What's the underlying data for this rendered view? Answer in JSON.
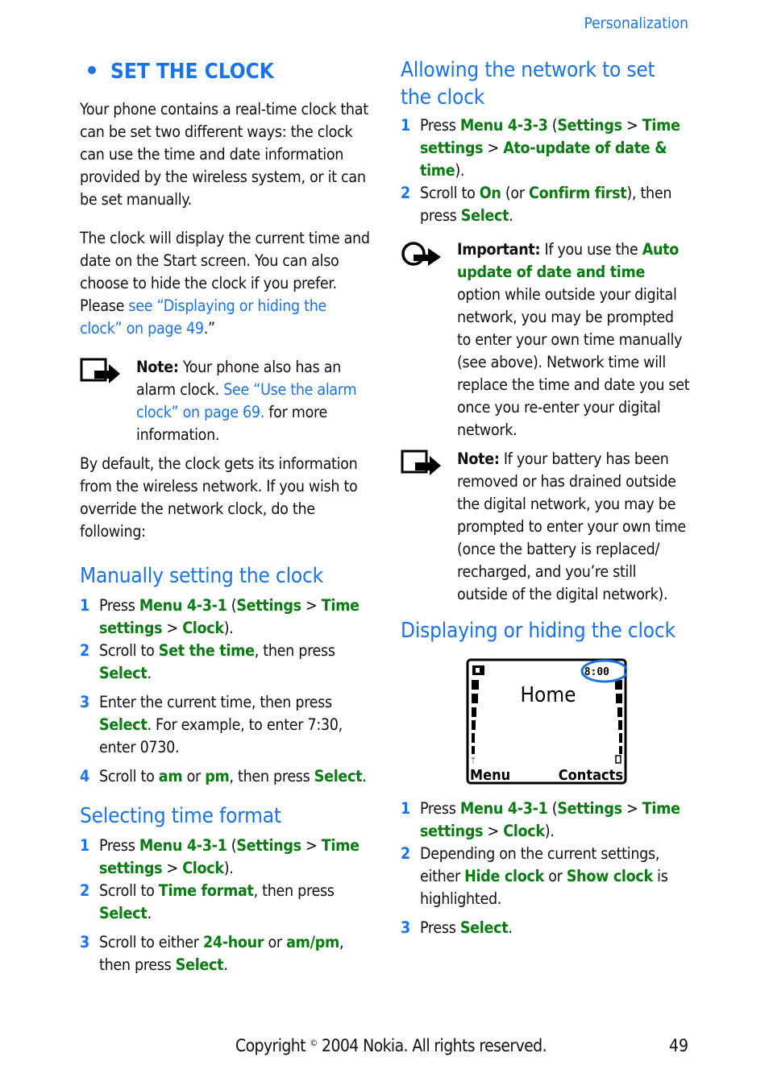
{
  "header": {
    "section": "Personalization"
  },
  "left": {
    "title": "SET THE CLOCK",
    "intro": "Your phone contains a real-time clock that can be set two different ways: the clock can use the time and date information provided by the wireless system, or it can be set manually.",
    "para2_text": "The clock will display the current time and date on the Start screen. You can also choose to hide the clock if you prefer. Please ",
    "para2_link": "see “Displaying or hiding the clock” on page 49",
    "para2_end": ".”",
    "note": {
      "label": "Note:",
      "text": " Your phone also has an alarm clock. ",
      "link": "See “Use the alarm clock” on page 69.",
      "end": " for more information."
    },
    "para3": "By default, the clock gets its information from the wireless network. If you wish to override the network clock, do the following:",
    "manual": {
      "heading": "Manually setting the clock",
      "steps": [
        {
          "num": "1",
          "t1": "Press ",
          "k1": "Menu 4-3-1",
          "t2": " (",
          "k2": "Settings",
          "t3": " > ",
          "k3": "Time settings",
          "t4": " > ",
          "k4": "Clock",
          "t5": ")."
        },
        {
          "num": "2",
          "t1": "Scroll to ",
          "k1": "Set the time",
          "t2": ", then press ",
          "k2": "Select",
          "t3": "."
        },
        {
          "num": "3",
          "t1": "Enter the current time, then press ",
          "k1": "Select",
          "t2": ". For example, to enter 7:30, enter 0730."
        },
        {
          "num": "4",
          "t1": "Scroll to ",
          "k1": "am",
          "t2": " or ",
          "k2": "pm",
          "t3": ", then press ",
          "k3": "Select",
          "t4": "."
        }
      ]
    },
    "format": {
      "heading": "Selecting time format",
      "steps": [
        {
          "num": "1",
          "t1": "Press ",
          "k1": "Menu 4-3-1",
          "t2": " (",
          "k2": "Settings",
          "t3": " > ",
          "k3": "Time settings",
          "t4": " > ",
          "k4": "Clock",
          "t5": ")."
        },
        {
          "num": "2",
          "t1": "Scroll to ",
          "k1": "Time format",
          "t2": ", then press ",
          "k2": "Select",
          "t3": "."
        },
        {
          "num": "3",
          "t1": "Scroll to either ",
          "k1": "24-hour",
          "t2": " or ",
          "k2": "am/pm",
          "t3": ", then press ",
          "k3": "Select",
          "t4": "."
        }
      ]
    }
  },
  "right": {
    "network": {
      "heading": "Allowing the network to set the clock",
      "steps": [
        {
          "num": "1",
          "t1": "Press ",
          "k1": "Menu 4-3-3",
          "t2": " (",
          "k2": "Settings",
          "t3": " > ",
          "k3": "Time settings",
          "t4": " > ",
          "k4": "Ato-update of date & time",
          "t5": ")."
        },
        {
          "num": "2",
          "t1": "Scroll to ",
          "k1": "On",
          "t2": " (or ",
          "k2": "Confirm first",
          "t3": "), then press ",
          "k3": "Select",
          "t4": "."
        }
      ]
    },
    "important": {
      "label": "Important:",
      "t1": " If you use the ",
      "k1": "Auto update of date and time",
      "t2": " option while outside your digital network, you may be prompted to enter your own time manually (see above). Network time will replace the time and date you set once you re-enter your digital network."
    },
    "note": {
      "label": "Note:",
      "text": " If your battery has been removed or has drained outside the digital network, you may be prompted to enter your own time (once the battery is replaced/ recharged, and you’re still outside of the digital network)."
    },
    "display": {
      "heading": "Displaying or hiding the clock",
      "phone": {
        "title": "Home",
        "clock": "8:00",
        "left_soft": "Menu",
        "right_soft": "Contacts",
        "highlight_color": "#1a73e8"
      },
      "steps": [
        {
          "num": "1",
          "t1": "Press ",
          "k1": "Menu 4-3-1",
          "t2": " (",
          "k2": "Settings",
          "t3": " > ",
          "k3": "Time settings",
          "t4": " > ",
          "k4": "Clock",
          "t5": ")."
        },
        {
          "num": "2",
          "t1": "Depending on the current settings, either ",
          "k1": "Hide clock",
          "t2": " or ",
          "k2": "Show clock",
          "t3": " is highlighted."
        },
        {
          "num": "3",
          "t1": "Press ",
          "k1": "Select",
          "t2": "."
        }
      ]
    }
  },
  "footer": {
    "copyright_pre": "Copyright ",
    "copyright_sym": "©",
    "copyright_post": " 2004 Nokia. All rights reserved.",
    "page": "49"
  }
}
